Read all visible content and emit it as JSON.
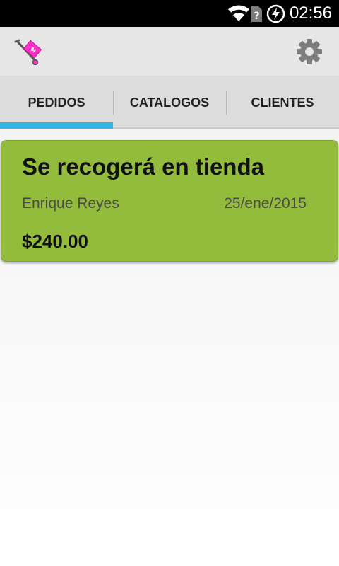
{
  "status_bar": {
    "time": "02:56",
    "icons": [
      "wifi-icon",
      "no-sim-icon",
      "battery-charging-icon"
    ]
  },
  "action_bar": {
    "logo_icon": "hand-truck-icon",
    "settings_icon": "gear-icon"
  },
  "tabs": [
    {
      "label": "PEDIDOS",
      "selected": true
    },
    {
      "label": "CATALOGOS",
      "selected": false
    },
    {
      "label": "CLIENTES",
      "selected": false
    }
  ],
  "orders": [
    {
      "title": "Se recogerá en tienda",
      "client": "Enrique Reyes",
      "date": "25/ene/2015",
      "total": "$240.00"
    }
  ],
  "colors": {
    "status_bar_bg": "#000000",
    "action_bar_bg": "#e6e6e6",
    "tab_bar_bg": "#dcdcdc",
    "tab_indicator": "#33b5e5",
    "card_bg": "#93bc3c",
    "logo_accent": "#ff33cc"
  }
}
